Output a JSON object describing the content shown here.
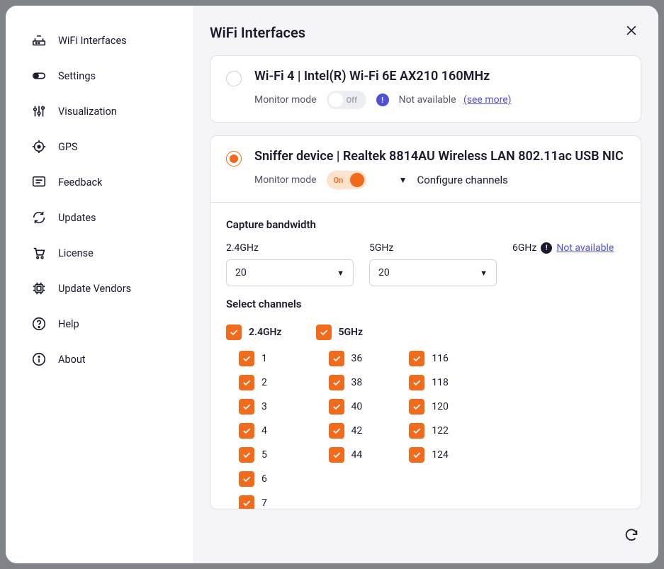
{
  "sidebar": {
    "items": [
      {
        "label": "WiFi Interfaces"
      },
      {
        "label": "Settings"
      },
      {
        "label": "Visualization"
      },
      {
        "label": "GPS"
      },
      {
        "label": "Feedback"
      },
      {
        "label": "Updates"
      },
      {
        "label": "License"
      },
      {
        "label": "Update Vendors"
      },
      {
        "label": "Help"
      },
      {
        "label": "About"
      }
    ]
  },
  "main": {
    "title": "WiFi Interfaces"
  },
  "interfaces": [
    {
      "title": "Wi-Fi 4 | Intel(R) Wi-Fi 6E AX210 160MHz",
      "monitor_label": "Monitor mode",
      "toggle_state": "Off",
      "not_available": "Not available",
      "see_more": "(see more)"
    },
    {
      "title": "Sniffer device | Realtek 8814AU Wireless LAN 802.11ac USB NIC",
      "monitor_label": "Monitor mode",
      "toggle_state": "On",
      "configure": "Configure channels"
    }
  ],
  "bandwidth": {
    "section": "Capture bandwidth",
    "g24": {
      "label": "2.4GHz",
      "value": "20"
    },
    "g5": {
      "label": "5GHz",
      "value": "20"
    },
    "g6": {
      "label": "6GHz",
      "not_available": "Not available"
    }
  },
  "channels": {
    "section": "Select channels",
    "g24": {
      "label": "2.4GHz",
      "list": [
        "1",
        "2",
        "3",
        "4",
        "5",
        "6",
        "7"
      ]
    },
    "g5": {
      "label": "5GHz",
      "col1": [
        "36",
        "38",
        "40",
        "42",
        "44"
      ],
      "col2": [
        "116",
        "118",
        "120",
        "122",
        "124"
      ]
    }
  }
}
